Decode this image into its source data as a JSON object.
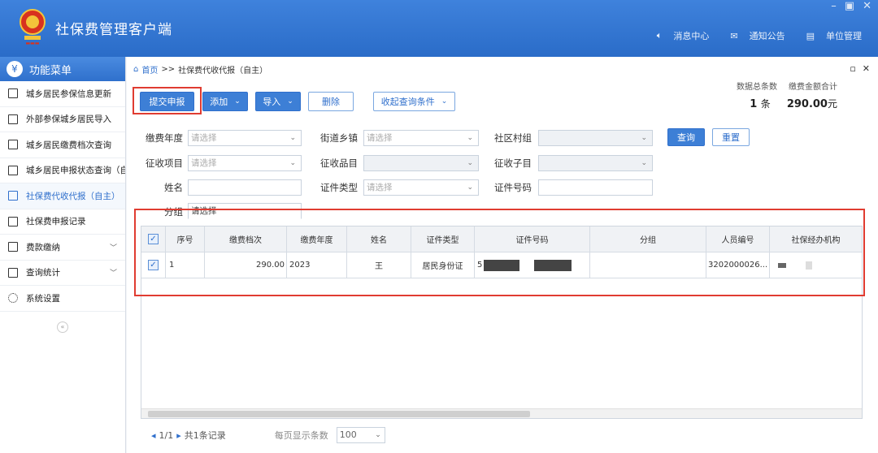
{
  "app": {
    "title": "社保费管理客户端"
  },
  "header_links": [
    {
      "icon": "speaker-icon",
      "label": "消息中心"
    },
    {
      "icon": "mail-icon",
      "label": "通知公告"
    },
    {
      "icon": "building-icon",
      "label": "单位管理"
    }
  ],
  "sidebar": {
    "title": "功能菜单",
    "items": [
      {
        "label": "城乡居民参保信息更新",
        "icon": "list-icon"
      },
      {
        "label": "外部参保城乡居民导入",
        "icon": "doc-icon"
      },
      {
        "label": "城乡居民缴费档次查询",
        "icon": "chart-icon"
      },
      {
        "label": "城乡居民申报状态查询（自主）",
        "icon": "edit-icon"
      },
      {
        "label": "社保费代收代报（自主）",
        "icon": "edit-icon",
        "active": true
      },
      {
        "label": "社保费申报记录",
        "icon": "doc-icon"
      },
      {
        "label": "费款缴纳",
        "icon": "book-icon",
        "expandable": true
      },
      {
        "label": "查询统计",
        "icon": "chart-icon",
        "expandable": true
      },
      {
        "label": "系统设置",
        "icon": "gear-icon"
      }
    ],
    "collapse_label": "«"
  },
  "breadcrumb": {
    "home": "首页",
    "sep": ">>",
    "current": "社保费代收代报（自主）"
  },
  "toolbar": {
    "submit": "提交申报",
    "add": "添加",
    "import": "导入",
    "delete": "删除",
    "collapse": "收起查询条件"
  },
  "stats": {
    "count_label": "数据总条数",
    "amount_label": "缴费金额合计",
    "count": "1",
    "count_unit": "条",
    "amount": "290.00",
    "amount_unit": "元"
  },
  "filters": {
    "year_label": "缴费年度",
    "year_placeholder": "请选择",
    "street_label": "街道乡镇",
    "street_placeholder": "请选择",
    "community_label": "社区村组",
    "item_label": "征收项目",
    "item_placeholder": "请选择",
    "goods_label": "征收品目",
    "subitem_label": "征收子目",
    "name_label": "姓名",
    "idtype_label": "证件类型",
    "idtype_placeholder": "请选择",
    "idno_label": "证件号码",
    "group_label": "分组",
    "group_placeholder": "请选择",
    "query": "查询",
    "reset": "重置"
  },
  "table": {
    "columns": [
      "序号",
      "缴费档次",
      "缴费年度",
      "姓名",
      "证件类型",
      "证件号码",
      "分组",
      "人员编号",
      "社保经办机构"
    ],
    "rows": [
      {
        "no": "1",
        "grade": "290.00",
        "year": "2023",
        "name": "王",
        "idtype": "居民身份证",
        "idno_prefix": "5",
        "group": "",
        "person_no": "3202000026..."
      }
    ],
    "hscroll_label": "III"
  },
  "pager": {
    "nav": "1/1",
    "total": "共1条记录",
    "per_page_label": "每页显示条数",
    "per_page": "100"
  }
}
